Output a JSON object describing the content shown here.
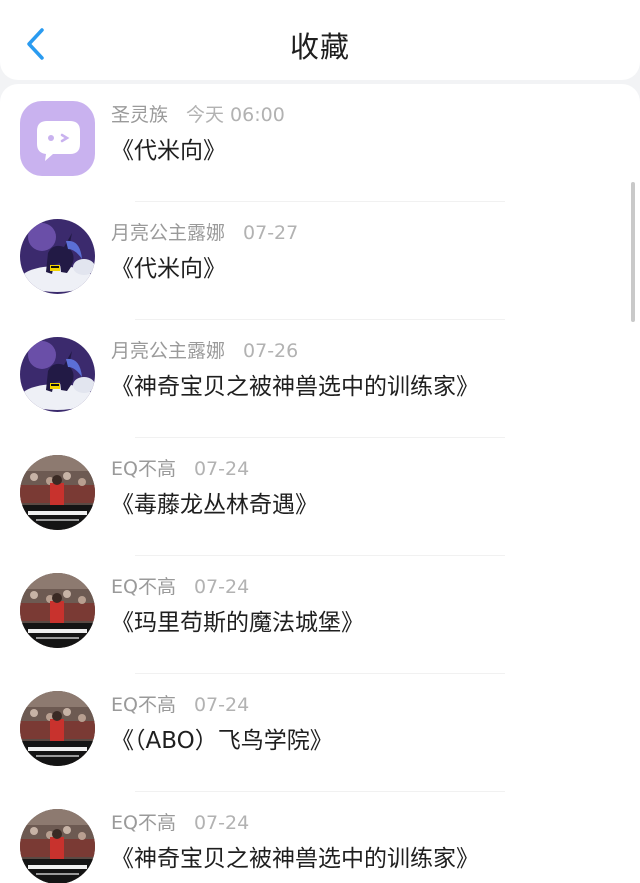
{
  "header": {
    "title": "收藏",
    "back_icon": "chevron-left-icon",
    "accent": "#2a9bf0"
  },
  "favorites": [
    {
      "author": "圣灵族",
      "time": "今天 06:00",
      "book": "《代米向》",
      "avatar": "chat-bubble-icon"
    },
    {
      "author": "月亮公主露娜",
      "time": "07-27",
      "book": "《代米向》",
      "avatar": "pony-avatar"
    },
    {
      "author": "月亮公主露娜",
      "time": "07-26",
      "book": "《神奇宝贝之被神兽选中的训练家》",
      "avatar": "pony-avatar"
    },
    {
      "author": "EQ不高",
      "time": "07-24",
      "book": "《毒藤龙丛林奇遇》",
      "avatar": "basketball-avatar"
    },
    {
      "author": "EQ不高",
      "time": "07-24",
      "book": "《玛里苟斯的魔法城堡》",
      "avatar": "basketball-avatar"
    },
    {
      "author": "EQ不高",
      "time": "07-24",
      "book": "《（ABO）飞鸟学院》",
      "avatar": "basketball-avatar"
    },
    {
      "author": "EQ不高",
      "time": "07-24",
      "book": "《神奇宝贝之被神兽选中的训练家》",
      "avatar": "basketball-avatar"
    }
  ]
}
